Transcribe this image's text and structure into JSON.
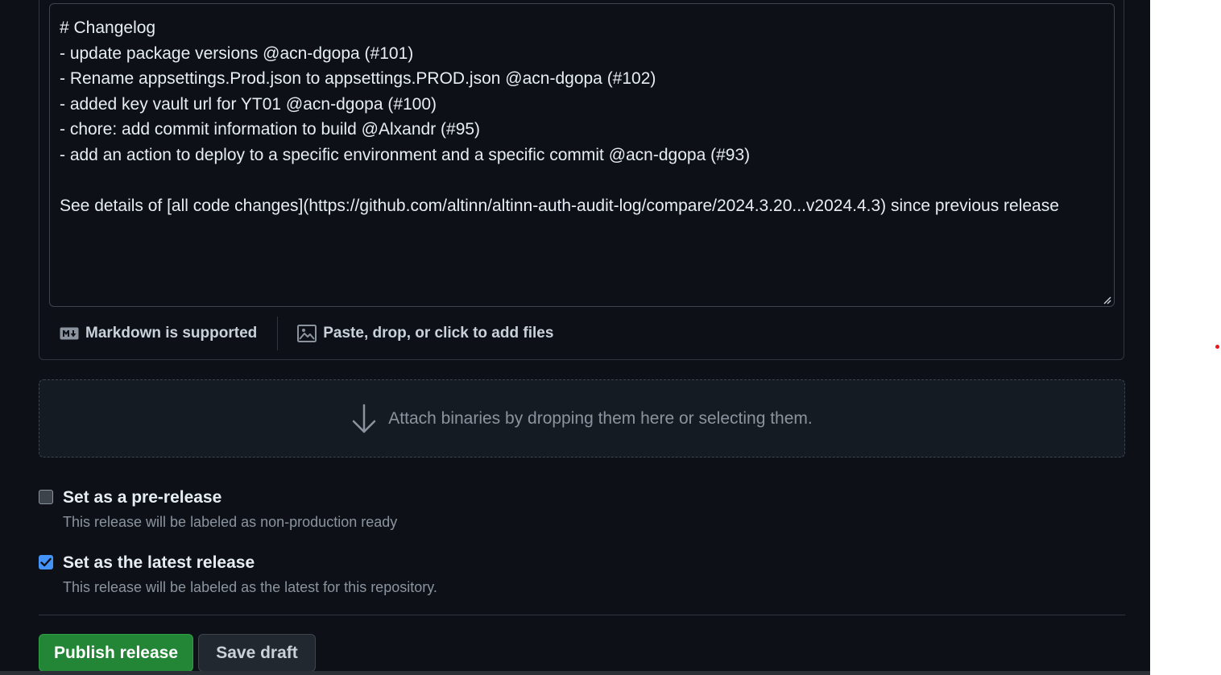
{
  "editor": {
    "content": "# Changelog\n- update package versions @acn-dgopa (#101)\n- Rename appsettings.Prod.json to appsettings.PROD.json @acn-dgopa (#102)\n- added key vault url for YT01 @acn-dgopa (#100)\n- chore: add commit information to build @Alxandr (#95)\n- add an action to deploy to a specific environment and a specific commit @acn-dgopa (#93)\n\nSee details of [all code changes](https://github.com/altinn/altinn-auth-audit-log/compare/2024.3.20...v2024.4.3) since previous release",
    "markdown_label": "Markdown is supported",
    "files_label": "Paste, drop, or click to add files"
  },
  "dropzone": {
    "text": "Attach binaries by dropping them here or selecting them."
  },
  "options": {
    "prerelease": {
      "title": "Set as a pre-release",
      "description": "This release will be labeled as non-production ready",
      "checked": false
    },
    "latest": {
      "title": "Set as the latest release",
      "description": "This release will be labeled as the latest for this repository.",
      "checked": true
    }
  },
  "actions": {
    "publish_label": "Publish release",
    "draft_label": "Save draft"
  },
  "colors": {
    "background": "#0d1117",
    "border": "#30363d",
    "primary_button": "#238636",
    "checkbox_checked": "#4493f8",
    "muted_text": "#8b949e"
  }
}
